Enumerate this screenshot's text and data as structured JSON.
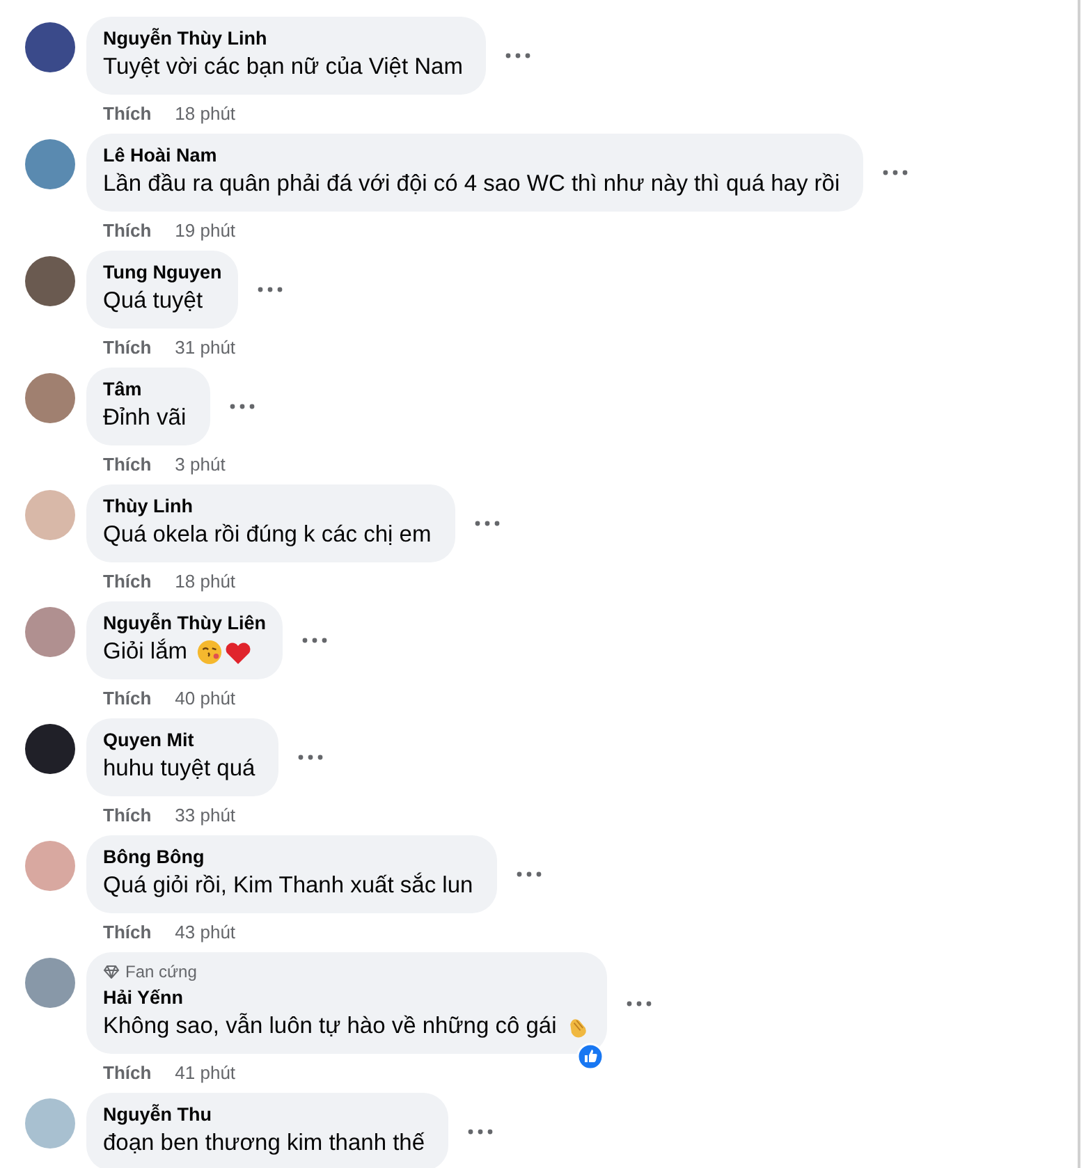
{
  "comments": [
    {
      "name": "Nguyễn Thùy Linh",
      "text": "Tuyệt vời các bạn nữ của Việt Nam",
      "like": "Thích",
      "time": "18 phút"
    },
    {
      "name": "Lê Hoài Nam",
      "text": "Lần đầu ra quân phải đá với đội có 4 sao WC thì như này thì quá hay rồi",
      "like": "Thích",
      "time": "19 phút"
    },
    {
      "name": "Tung Nguyen",
      "text": "Quá tuyệt",
      "like": "Thích",
      "time": "31 phút"
    },
    {
      "name": "Tâm",
      "text": "Đỉnh vãi",
      "like": "Thích",
      "time": "3 phút"
    },
    {
      "name": "Thùy Linh",
      "text": "Quá okela rồi đúng k các chị em",
      "like": "Thích",
      "time": "18 phút"
    },
    {
      "name": "Nguyễn Thùy Liên",
      "text": "Giỏi lắm",
      "emojis": [
        {
          "kind": "kiss"
        },
        {
          "kind": "heart"
        }
      ],
      "like": "Thích",
      "time": "40 phút"
    },
    {
      "name": "Quyen Mit",
      "text": "huhu tuyệt quá",
      "like": "Thích",
      "time": "33 phút"
    },
    {
      "name": "Bông Bông",
      "text": "Quá giỏi rồi, Kim Thanh xuất sắc lun",
      "like": "Thích",
      "time": "43 phút"
    },
    {
      "badge": "Fan cứng",
      "name": "Hải Yếnn",
      "text": "Không sao, vẫn luôn tự hào về những cô gái",
      "emojis": [
        {
          "kind": "clap"
        }
      ],
      "reaction": {
        "kind": "like"
      },
      "like": "Thích",
      "time": "41 phút"
    },
    {
      "name": "Nguyễn Thu",
      "text": "đoạn ben thương kim thanh thế"
    }
  ]
}
